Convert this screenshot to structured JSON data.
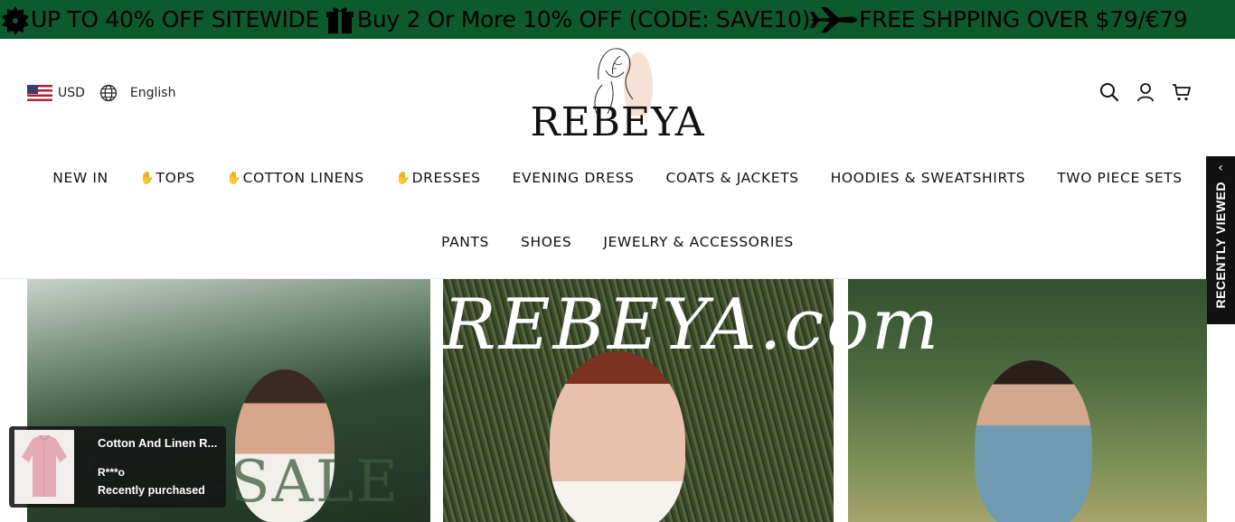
{
  "announcement": {
    "promo_1": "UP TO 40% OFF SITEWIDE",
    "promo_2": "Buy 2 Or More 10% OFF (CODE: SAVE10)",
    "promo_3": "FREE SHPPING OVER $79/€79",
    "background": "#0d5a2c"
  },
  "header": {
    "currency": "USD",
    "language": "English",
    "logo_text": "REBEYA",
    "icons": [
      "search-icon",
      "account-icon",
      "cart-icon"
    ]
  },
  "nav": {
    "row1": [
      {
        "label": "NEW IN",
        "hand": false
      },
      {
        "label": "TOPS",
        "hand": true
      },
      {
        "label": "COTTON LINENS",
        "hand": true
      },
      {
        "label": "DRESSES",
        "hand": true
      },
      {
        "label": "EVENING DRESS",
        "hand": false
      },
      {
        "label": "COATS & JACKETS",
        "hand": false
      },
      {
        "label": "HOODIES & SWEATSHIRTS",
        "hand": false
      },
      {
        "label": "TWO PIECE SETS",
        "hand": false
      }
    ],
    "row2": [
      {
        "label": "PANTS",
        "hand": false
      },
      {
        "label": "SHOES",
        "hand": false
      },
      {
        "label": "JEWELRY & ACCESSORIES",
        "hand": false
      }
    ],
    "hand_glyph": "✋"
  },
  "recently_viewed": {
    "label": "RECENTLY VIEWED",
    "chevron": "‹"
  },
  "banners": {
    "sale_text": "PRE-SALE",
    "watermark": "REBEYA.com"
  },
  "popup": {
    "product_name": "Cotton And Linen R...",
    "buyer": "R***o",
    "status": "Recently purchased"
  }
}
